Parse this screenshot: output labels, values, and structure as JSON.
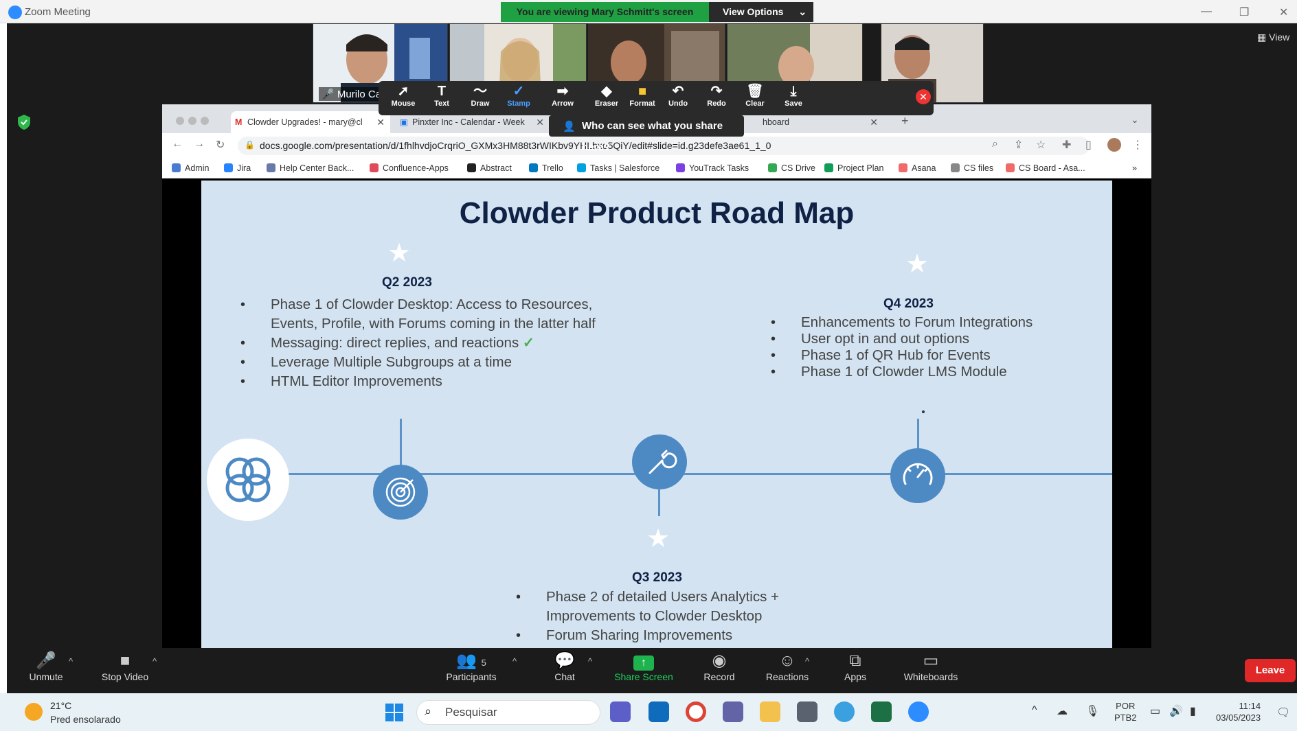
{
  "window": {
    "title": "Zoom Meeting"
  },
  "banner": {
    "viewing": "You are viewing Mary Schmitt's screen",
    "view_options": "View Options"
  },
  "participants_strip": {
    "name_tag": "Murilo Ca",
    "view_label": "View"
  },
  "annotation_toolbar": {
    "tools": [
      "Mouse",
      "Text",
      "Draw",
      "Stamp",
      "Arrow",
      "Eraser",
      "Format",
      "Undo",
      "Redo",
      "Clear",
      "Save"
    ],
    "icons": [
      "cursor-icon",
      "text-icon",
      "draw-icon",
      "stamp-icon",
      "arrow-icon",
      "eraser-icon",
      "format-icon",
      "undo-icon",
      "redo-icon",
      "clear-icon",
      "save-icon"
    ],
    "active_tool": "Stamp",
    "who_can_see": "Who can see what you share here?"
  },
  "browser": {
    "tabs": [
      {
        "label": "Clowder Upgrades! - mary@cl"
      },
      {
        "label": "Pinxter Inc - Calendar - Week"
      },
      {
        "label": "hboard"
      }
    ],
    "url": "docs.google.com/presentation/d/1fhlhvdjoCrqriO_GXMx3HM88t3rWIKbv9YHLbxo5QiY/edit#slide=id.g23defe3ae61_1_0",
    "bookmarks": [
      "Admin",
      "Jira",
      "Help Center Back...",
      "Confluence-Apps",
      "Abstract",
      "Trello",
      "Tasks | Salesforce",
      "YouTrack Tasks",
      "CS Drive",
      "Project Plan",
      "Asana",
      "CS files",
      "CS Board - Asa..."
    ]
  },
  "slide": {
    "title": "Clowder Product Road Map",
    "q2": {
      "heading": "Q2 2023",
      "items": [
        "Phase 1 of Clowder Desktop: Access to Resources, Events, Profile, with Forums coming in the latter half",
        "Messaging: direct replies, and reactions",
        "Leverage Multiple Subgroups at a time",
        "HTML Editor Improvements"
      ]
    },
    "q3": {
      "heading": "Q3 2023",
      "items": [
        "Phase 2 of detailed Users Analytics + Improvements to Clowder Desktop",
        "Forum Sharing Improvements"
      ]
    },
    "q4": {
      "heading": "Q4 2023",
      "items": [
        "Enhancements to Forum Integrations",
        "User opt in and out options",
        "Phase 1 of QR Hub for Events",
        "Phase 1 of Clowder LMS Module"
      ]
    }
  },
  "controls": {
    "unmute": "Unmute",
    "stop_video": "Stop Video",
    "participants": "Participants",
    "participants_count": "5",
    "chat": "Chat",
    "share_screen": "Share Screen",
    "record": "Record",
    "reactions": "Reactions",
    "apps": "Apps",
    "whiteboards": "Whiteboards",
    "leave": "Leave"
  },
  "taskbar": {
    "temperature": "21°C",
    "weather": "Pred ensolarado",
    "search_placeholder": "Pesquisar",
    "lang_1": "POR",
    "lang_2": "PTB2",
    "time": "11:14",
    "date": "03/05/2023"
  },
  "colors": {
    "zoom_blue": "#2d8cff",
    "banner_green": "#1fa043",
    "leave_red": "#e02828",
    "slide_bg": "#d3e3f1",
    "title_navy": "#0f2245",
    "timeline_blue": "#5b93c9"
  }
}
